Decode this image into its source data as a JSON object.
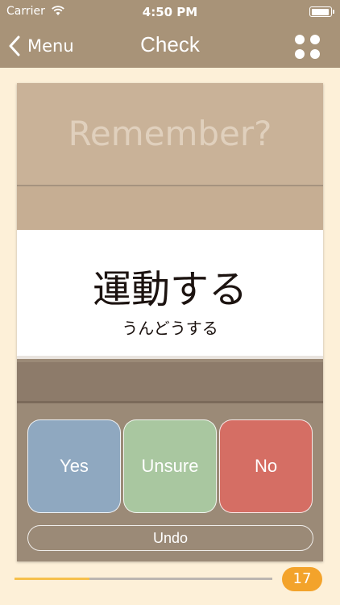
{
  "status_bar": {
    "carrier": "Carrier",
    "time": "4:50 PM",
    "wifi_icon": "wifi-icon",
    "battery_icon": "battery-icon"
  },
  "nav": {
    "back_label": "Menu",
    "back_icon": "chevron-left-icon",
    "title": "Check",
    "grid_icon": "four-dots-grid-icon"
  },
  "card": {
    "prompt": "Remember?",
    "word": "運動する",
    "reading": "うんどうする"
  },
  "answers": {
    "yes": "Yes",
    "unsure": "Unsure",
    "no": "No",
    "undo": "Undo"
  },
  "progress": {
    "fraction": 0.29,
    "count": "17"
  },
  "colors": {
    "bar": "#a89378",
    "background": "#fdf0d8",
    "yes": "#8fa8c0",
    "unsure": "#a9c7a0",
    "no": "#d56e64",
    "badge": "#f3a32b",
    "progress": "#f6c04b"
  }
}
